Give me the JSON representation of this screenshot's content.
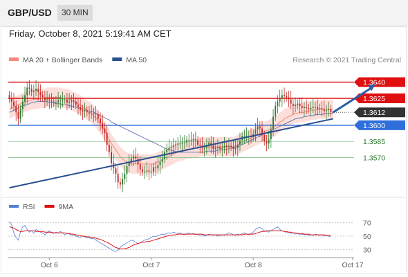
{
  "header": {
    "symbol": "GBP/USD",
    "timeframe": "30 MIN"
  },
  "datetime": "Friday, October 8, 2021 5:19:41 AM CET",
  "copyright": "Research © 2021 Trading Central",
  "chart_data": {
    "type": "candlestick",
    "price_panel": {
      "ylim": [
        1.3535,
        1.3652
      ],
      "legend": [
        {
          "name": "MA 20 + Bollinger Bands",
          "color": "#f4877f"
        },
        {
          "name": "MA 50",
          "color": "#2a4f8f"
        }
      ],
      "levels": [
        {
          "value": 1.364,
          "label": "1.3640",
          "kind": "resistance",
          "color": "#e01010"
        },
        {
          "value": 1.3625,
          "label": "1.3625",
          "kind": "resistance",
          "color": "#e01010"
        },
        {
          "value": 1.3612,
          "label": "1.3612",
          "kind": "last",
          "color": "#333333"
        },
        {
          "value": 1.36,
          "label": "1.3600",
          "kind": "pivot",
          "color": "#2f6fdc"
        },
        {
          "value": 1.3585,
          "label": "1.3585",
          "kind": "support",
          "color": "#2e7d32"
        },
        {
          "value": 1.357,
          "label": "1.3570",
          "kind": "support",
          "color": "#2e7d32"
        }
      ],
      "trendline": {
        "from": [
          0,
          1.3542
        ],
        "to": [
          146,
          1.3606
        ]
      },
      "forecast_arrow": {
        "from": [
          146,
          1.3612
        ],
        "to": [
          162,
          1.3638
        ]
      },
      "close_series": [
        1.3625,
        1.3622,
        1.3618,
        1.3612,
        1.3606,
        1.3615,
        1.3622,
        1.3628,
        1.3635,
        1.3634,
        1.3631,
        1.3632,
        1.3634,
        1.3631,
        1.3628,
        1.3626,
        1.3623,
        1.3624,
        1.3623,
        1.3622,
        1.3621,
        1.3621,
        1.3623,
        1.3623,
        1.3624,
        1.3624,
        1.3621,
        1.3622,
        1.3623,
        1.3622,
        1.3619,
        1.3617,
        1.3614,
        1.3613,
        1.3614,
        1.3612,
        1.3611,
        1.3611,
        1.3611,
        1.361,
        1.3606,
        1.3602,
        1.3597,
        1.3593,
        1.3582,
        1.3575,
        1.3565,
        1.356,
        1.3555,
        1.3547,
        1.3545,
        1.355,
        1.3555,
        1.3562,
        1.3566,
        1.3569,
        1.3571,
        1.3569,
        1.3564,
        1.3559,
        1.3557,
        1.3557,
        1.3558,
        1.3557,
        1.3557,
        1.3561,
        1.356,
        1.3563,
        1.3566,
        1.3569,
        1.3575,
        1.3577,
        1.3579,
        1.358,
        1.3581,
        1.3582,
        1.3583,
        1.3583,
        1.3584,
        1.3584,
        1.3586,
        1.3586,
        1.3586,
        1.3587,
        1.3586,
        1.3582,
        1.3581,
        1.3579,
        1.3579,
        1.3581,
        1.3584,
        1.3581,
        1.3578,
        1.3579,
        1.358,
        1.3578,
        1.3579,
        1.3581,
        1.358,
        1.3581,
        1.358,
        1.3578,
        1.3579,
        1.3582,
        1.3586,
        1.359,
        1.359,
        1.359,
        1.359,
        1.3589,
        1.3592,
        1.3596,
        1.3599,
        1.3597,
        1.3591,
        1.3585,
        1.3583,
        1.3587,
        1.3596,
        1.3608,
        1.3618,
        1.3622,
        1.3625,
        1.3628,
        1.3627,
        1.3626,
        1.3624,
        1.362,
        1.3618,
        1.3619,
        1.362,
        1.3618,
        1.3616,
        1.3617,
        1.3616,
        1.3615,
        1.3616,
        1.3617,
        1.3617,
        1.3615,
        1.3616,
        1.3615,
        1.3613,
        1.3614,
        1.3615,
        1.3612
      ],
      "ma20": [
        1.3615,
        1.3616,
        1.3617,
        1.3618,
        1.3619,
        1.362,
        1.3621,
        1.3622,
        1.3622,
        1.3623,
        1.3623,
        1.3624,
        1.3624,
        1.3624,
        1.3625,
        1.3625,
        1.3625,
        1.3626,
        1.3626,
        1.3626,
        1.3626,
        1.3626,
        1.3626,
        1.3626,
        1.3625,
        1.3625,
        1.3625,
        1.3624,
        1.3623,
        1.3622,
        1.3621,
        1.362,
        1.3619,
        1.3617,
        1.3616,
        1.3614,
        1.3613,
        1.3611,
        1.3609,
        1.3607,
        1.3604,
        1.3601,
        1.3598,
        1.3595,
        1.3591,
        1.3587,
        1.3583,
        1.358,
        1.3577,
        1.3574,
        1.3571,
        1.3569,
        1.3567,
        1.3566,
        1.3565,
        1.3564,
        1.3564,
        1.3564,
        1.3564,
        1.3564,
        1.3564,
        1.3564,
        1.3564,
        1.3564,
        1.3564,
        1.3564,
        1.3565,
        1.3566,
        1.3567,
        1.3568,
        1.3569,
        1.357,
        1.3571,
        1.3572,
        1.3573,
        1.3574,
        1.3575,
        1.3576,
        1.3576,
        1.3577,
        1.3578,
        1.3578,
        1.3578,
        1.3579,
        1.3579,
        1.3579,
        1.358,
        1.358,
        1.358,
        1.358,
        1.358,
        1.358,
        1.358,
        1.358,
        1.358,
        1.358,
        1.358,
        1.358,
        1.358,
        1.358,
        1.358,
        1.358,
        1.3581,
        1.3582,
        1.3583,
        1.3584,
        1.3585,
        1.3586,
        1.3587,
        1.3588,
        1.3589,
        1.359,
        1.3591,
        1.3592,
        1.3593,
        1.3594,
        1.3595,
        1.3596,
        1.3597,
        1.3598,
        1.3599,
        1.3601,
        1.3603,
        1.3604,
        1.3606,
        1.3607,
        1.3608,
        1.3609,
        1.361,
        1.3611,
        1.3611,
        1.3612,
        1.3612,
        1.3612,
        1.3613,
        1.3613,
        1.3614,
        1.3614,
        1.3614,
        1.3615,
        1.3615,
        1.3615,
        1.3615,
        1.3615,
        1.3615,
        1.3615,
        1.3615
      ],
      "ma50": [
        1.3612,
        1.3613,
        1.3614,
        1.3615,
        1.3616,
        1.3617,
        1.3618,
        1.3619,
        1.3619,
        1.362,
        1.3621,
        1.3621,
        1.3622,
        1.3622,
        1.3622,
        1.3622,
        1.3622,
        1.3622,
        1.3621,
        1.3621,
        1.3621,
        1.362,
        1.362,
        1.362,
        1.3619,
        1.3619,
        1.3619,
        1.3618,
        1.3618,
        1.3617,
        1.3617,
        1.3616,
        1.3616,
        1.3615,
        1.3615,
        1.3614,
        1.3613,
        1.3613,
        1.3612,
        1.3611,
        1.361,
        1.3609,
        1.3608,
        1.3607,
        1.3606,
        1.3605,
        1.3603,
        1.3602,
        1.3601,
        1.36,
        1.3599,
        1.3598,
        1.3597,
        1.3596,
        1.3595,
        1.3594,
        1.3593,
        1.3592,
        1.3591,
        1.359,
        1.3589,
        1.3588,
        1.3587,
        1.3586,
        1.3585,
        1.3584,
        1.3583,
        1.3582,
        1.3581,
        1.358,
        1.3579,
        1.3578,
        1.3577,
        1.3577,
        1.3576,
        1.3576,
        1.3575,
        1.3575,
        1.3575,
        1.3575,
        1.3575,
        1.3575,
        1.3575,
        1.3575,
        1.3575,
        1.3575,
        1.3575,
        1.3575,
        1.3575,
        1.3576,
        1.3576,
        1.3576,
        1.3576,
        1.3576,
        1.3577,
        1.3577,
        1.3577,
        1.3577,
        1.3578,
        1.3578,
        1.3579,
        1.3579,
        1.358,
        1.358,
        1.3581,
        1.3582,
        1.3583,
        1.3584,
        1.3585,
        1.3586,
        1.3587,
        1.3588,
        1.3589,
        1.359,
        1.3591,
        1.3592,
        1.3593,
        1.3594,
        1.3595,
        1.3596,
        1.3597,
        1.3598,
        1.3599,
        1.36,
        1.3601,
        1.3602,
        1.3603,
        1.3604,
        1.3605,
        1.3606,
        1.3606,
        1.3607,
        1.3607,
        1.3608,
        1.3608,
        1.3609,
        1.3609,
        1.3609,
        1.361,
        1.361,
        1.361,
        1.361,
        1.3611,
        1.3611,
        1.3611,
        1.3611,
        1.3611
      ]
    },
    "rsi_panel": {
      "legend": [
        {
          "name": "RSI",
          "color": "#5a7fd6"
        },
        {
          "name": "9MA",
          "color": "#e01010"
        }
      ],
      "ylim": [
        20,
        80
      ],
      "levels": [
        70,
        50,
        30
      ],
      "rsi": [
        72,
        67,
        55,
        48,
        44,
        56,
        64,
        66,
        60,
        56,
        58,
        54,
        60,
        58,
        56,
        55,
        52,
        55,
        58,
        55,
        54,
        56,
        55,
        57,
        55,
        52,
        54,
        53,
        51,
        52,
        50,
        49,
        48,
        50,
        49,
        47,
        48,
        46,
        47,
        44,
        42,
        40,
        38,
        36,
        34,
        32,
        30,
        28,
        27,
        29,
        33,
        36,
        38,
        40,
        42,
        44,
        43,
        41,
        39,
        40,
        42,
        44,
        45,
        46,
        48,
        50,
        49,
        51,
        52,
        53,
        52,
        54,
        55,
        54,
        56,
        55,
        54,
        55,
        53,
        52,
        54,
        55,
        53,
        54,
        52,
        53,
        51,
        52,
        50,
        51,
        53,
        52,
        51,
        52,
        50,
        51,
        52,
        51,
        53,
        55,
        54,
        52,
        51,
        53,
        52,
        54,
        55,
        53,
        52,
        54,
        56,
        60,
        62,
        63,
        61,
        58,
        57,
        56,
        58,
        60,
        62,
        64,
        60,
        58,
        57,
        55,
        56,
        54,
        55,
        53,
        54,
        52,
        53,
        52,
        53,
        51,
        52,
        51,
        53,
        52,
        51,
        52,
        50,
        51,
        50,
        49
      ],
      "ma9": [
        64,
        63,
        62,
        60,
        58,
        57,
        57,
        58,
        58,
        58,
        58,
        58,
        57,
        57,
        57,
        57,
        56,
        56,
        56,
        56,
        55,
        55,
        55,
        55,
        55,
        55,
        54,
        54,
        53,
        53,
        52,
        51,
        51,
        50,
        50,
        49,
        49,
        48,
        48,
        47,
        46,
        45,
        44,
        42,
        41,
        39,
        37,
        35,
        33,
        32,
        31,
        31,
        31,
        32,
        33,
        35,
        37,
        38,
        39,
        40,
        41,
        41,
        42,
        42,
        43,
        44,
        45,
        46,
        47,
        48,
        49,
        50,
        51,
        51,
        52,
        52,
        53,
        53,
        53,
        53,
        53,
        53,
        53,
        53,
        53,
        53,
        53,
        53,
        52,
        52,
        52,
        52,
        52,
        52,
        52,
        52,
        52,
        52,
        52,
        52,
        52,
        52,
        52,
        52,
        52,
        52,
        53,
        53,
        53,
        53,
        53,
        54,
        55,
        56,
        57,
        57,
        58,
        58,
        58,
        58,
        58,
        58,
        58,
        58,
        57,
        57,
        56,
        56,
        55,
        55,
        54,
        54,
        54,
        53,
        53,
        53,
        52,
        52,
        52,
        52,
        52,
        52,
        52,
        51,
        51,
        51
      ],
      "ytick_labels": [
        "70",
        "50",
        "30"
      ]
    },
    "x_tick_labels": [
      "Oct 6",
      "Oct 7",
      "Oct 8",
      "Oct 17"
    ],
    "x_ticks_at_bar": [
      18,
      64,
      110,
      130
    ]
  }
}
